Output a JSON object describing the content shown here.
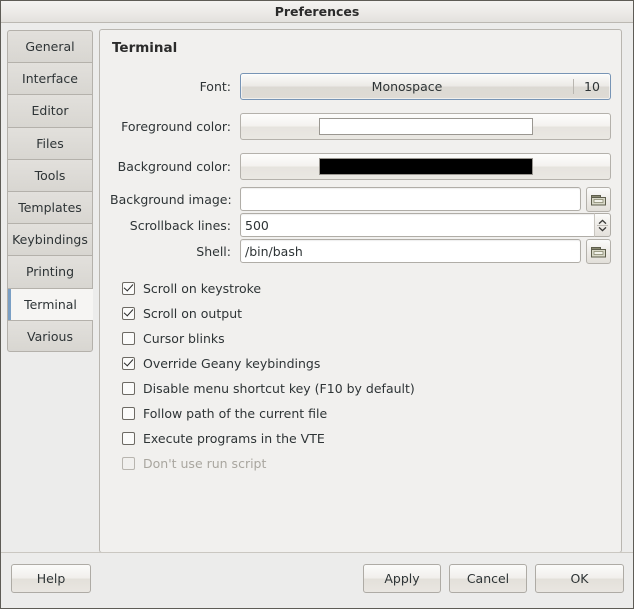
{
  "window": {
    "title": "Preferences"
  },
  "sidebar": {
    "items": [
      {
        "label": "General",
        "selected": false
      },
      {
        "label": "Interface",
        "selected": false
      },
      {
        "label": "Editor",
        "selected": false
      },
      {
        "label": "Files",
        "selected": false
      },
      {
        "label": "Tools",
        "selected": false
      },
      {
        "label": "Templates",
        "selected": false
      },
      {
        "label": "Keybindings",
        "selected": false
      },
      {
        "label": "Printing",
        "selected": false
      },
      {
        "label": "Terminal",
        "selected": true
      },
      {
        "label": "Various",
        "selected": false
      }
    ]
  },
  "panel": {
    "title": "Terminal",
    "fields": {
      "font": {
        "label": "Font:",
        "family": "Monospace",
        "size": "10"
      },
      "foreground_color": {
        "label": "Foreground color:",
        "value": "#ffffff"
      },
      "background_color": {
        "label": "Background color:",
        "value": "#000000"
      },
      "background_image": {
        "label": "Background image:",
        "value": "",
        "browse_icon": "folder-open-icon"
      },
      "scrollback_lines": {
        "label": "Scrollback lines:",
        "value": "500"
      },
      "shell": {
        "label": "Shell:",
        "value": "/bin/bash",
        "browse_icon": "folder-open-icon"
      }
    },
    "checkboxes": [
      {
        "label": "Scroll on keystroke",
        "checked": true,
        "enabled": true
      },
      {
        "label": "Scroll on output",
        "checked": true,
        "enabled": true
      },
      {
        "label": "Cursor blinks",
        "checked": false,
        "enabled": true
      },
      {
        "label": "Override Geany keybindings",
        "checked": true,
        "enabled": true
      },
      {
        "label": "Disable menu shortcut key (F10 by default)",
        "checked": false,
        "enabled": true
      },
      {
        "label": "Follow path of the current file",
        "checked": false,
        "enabled": true
      },
      {
        "label": "Execute programs in the VTE",
        "checked": false,
        "enabled": true
      },
      {
        "label": "Don't use run script",
        "checked": false,
        "enabled": false
      }
    ]
  },
  "footer": {
    "help": "Help",
    "apply": "Apply",
    "cancel": "Cancel",
    "ok": "OK"
  },
  "colors": {
    "accent": "#7a9fc4",
    "focus_border": "#7794b5",
    "window_bg": "#ececeb",
    "panel_bg": "#f1f0ee"
  }
}
